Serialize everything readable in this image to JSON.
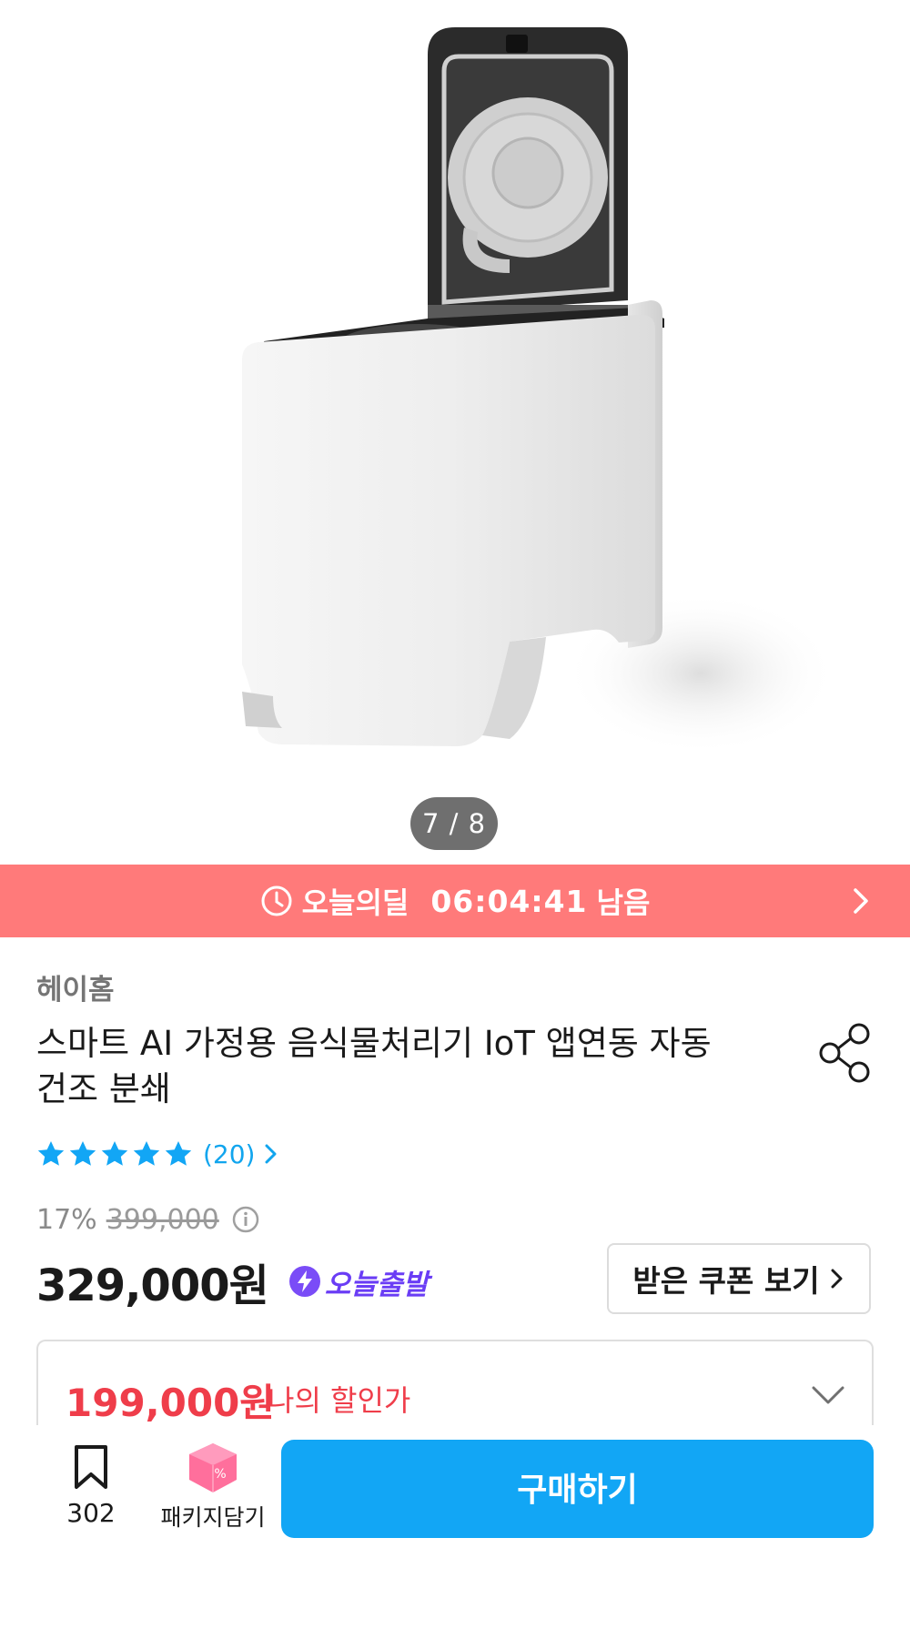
{
  "gallery": {
    "indicator": "7 / 8"
  },
  "deal": {
    "icon": "clock-icon",
    "label": "오늘의딜",
    "timer": "06:04:41",
    "remaining": "남음",
    "background": "#ff7a7a"
  },
  "product": {
    "brand": "헤이홈",
    "title": "스마트 AI 가정용 음식물처리기 IoT 앱연동 자동 건조 분쇄",
    "rating": {
      "stars": 5,
      "count": "(20)"
    },
    "discount_rate": "17%",
    "original_price": "399,000",
    "price": "329,000원",
    "delivery_badge": "오늘출발",
    "coupon_button": "받은 쿠폰 보기",
    "my_price": "199,000원",
    "my_price_label": "나의 할인가"
  },
  "bottom_bar": {
    "bookmark_count": "302",
    "package_label": "패키지담기",
    "buy_label": "구매하기"
  },
  "colors": {
    "accent": "#12a6f5",
    "deal": "#ff7a7a",
    "discount_price": "#ef3d4a",
    "today_badge": "#6a3df5"
  }
}
